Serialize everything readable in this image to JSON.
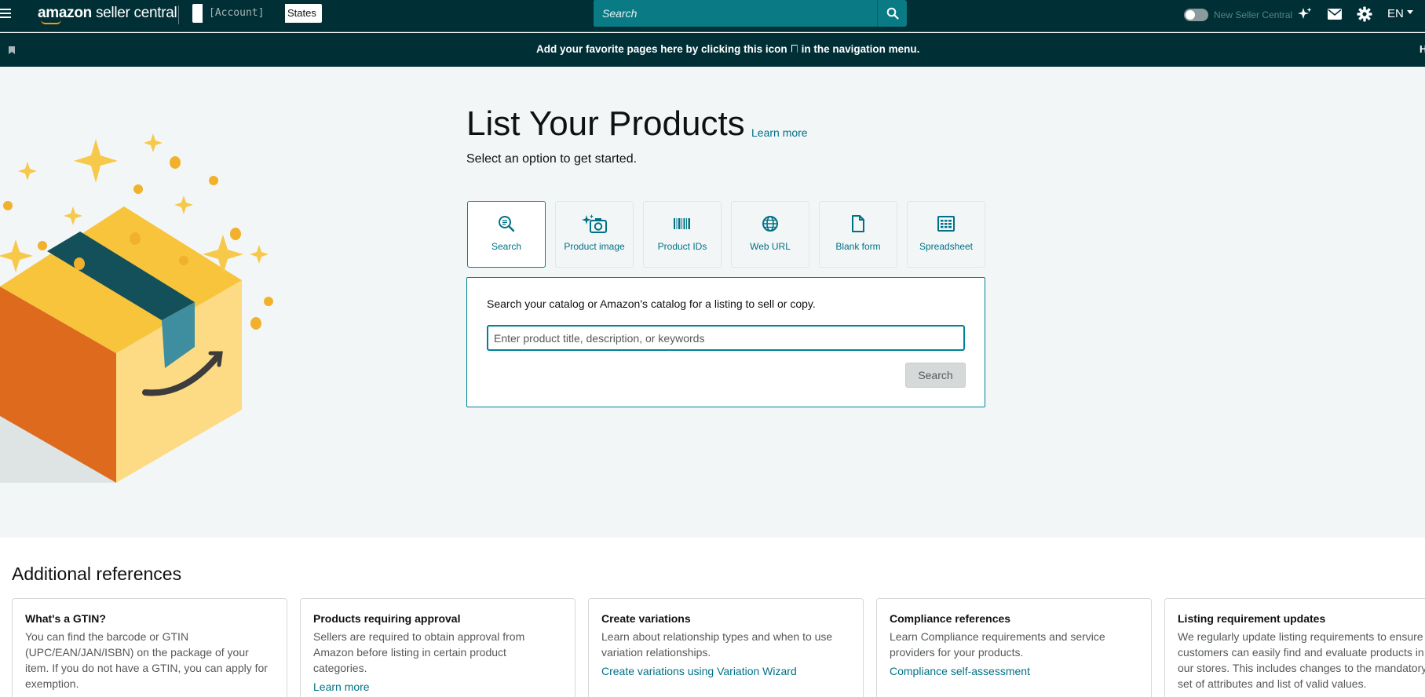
{
  "topnav": {
    "logo_brand": "amazon",
    "logo_product": "seller central",
    "account_masked": "[Account]",
    "account_country": "States",
    "search_placeholder": "Search",
    "toggle_label": "New Seller Central",
    "language": "EN",
    "icons": [
      "menu-icon",
      "search-icon",
      "sparkle-icon",
      "mail-icon",
      "gear-icon"
    ]
  },
  "favbar": {
    "text_before": "Add your favorite pages here by clicking this icon",
    "text_after": "in the navigation menu.",
    "edge_text": "H"
  },
  "hero": {
    "title": "List Your Products",
    "learn_more": "Learn more",
    "subtitle": "Select an option to get started.",
    "options": [
      {
        "label": "Search",
        "icon": "search-icon",
        "selected": true
      },
      {
        "label": "Product image",
        "icon": "camera-sparkle-icon",
        "selected": false
      },
      {
        "label": "Product IDs",
        "icon": "barcode-icon",
        "selected": false
      },
      {
        "label": "Web URL",
        "icon": "globe-icon",
        "selected": false
      },
      {
        "label": "Blank form",
        "icon": "document-icon",
        "selected": false
      },
      {
        "label": "Spreadsheet",
        "icon": "spreadsheet-icon",
        "selected": false
      }
    ],
    "panel": {
      "description": "Search your catalog or Amazon's catalog for a listing to sell or copy.",
      "input_placeholder": "Enter product title, description, or keywords",
      "button": "Search"
    }
  },
  "references": {
    "title": "Additional references",
    "cards": [
      {
        "title": "What's a GTIN?",
        "body": "You can find the barcode or GTIN (UPC/EAN/JAN/ISBN) on the package of your item. If you do not have a GTIN, you can apply for exemption.",
        "link": ""
      },
      {
        "title": "Products requiring approval",
        "body": "Sellers are required to obtain approval from Amazon before listing in certain product categories.",
        "link": "Learn more"
      },
      {
        "title": "Create variations",
        "body": "Learn about relationship types and when to use variation relationships.",
        "link": "Create variations using Variation Wizard"
      },
      {
        "title": "Compliance references",
        "body": "Learn Compliance requirements and service providers for your products.",
        "link": "Compliance self-assessment"
      },
      {
        "title": "Listing requirement updates",
        "body": "We regularly update listing requirements to ensure customers can easily find and evaluate products in our stores. This includes changes to the mandatory set of attributes and list of valid values.",
        "link": ""
      }
    ]
  },
  "colors": {
    "nav_bg": "#002f36",
    "accent": "#008296",
    "link": "#007185",
    "box_orange": "#de6a1e",
    "box_yellow": "#f7c43c",
    "sparkle": "#f7c94a"
  }
}
